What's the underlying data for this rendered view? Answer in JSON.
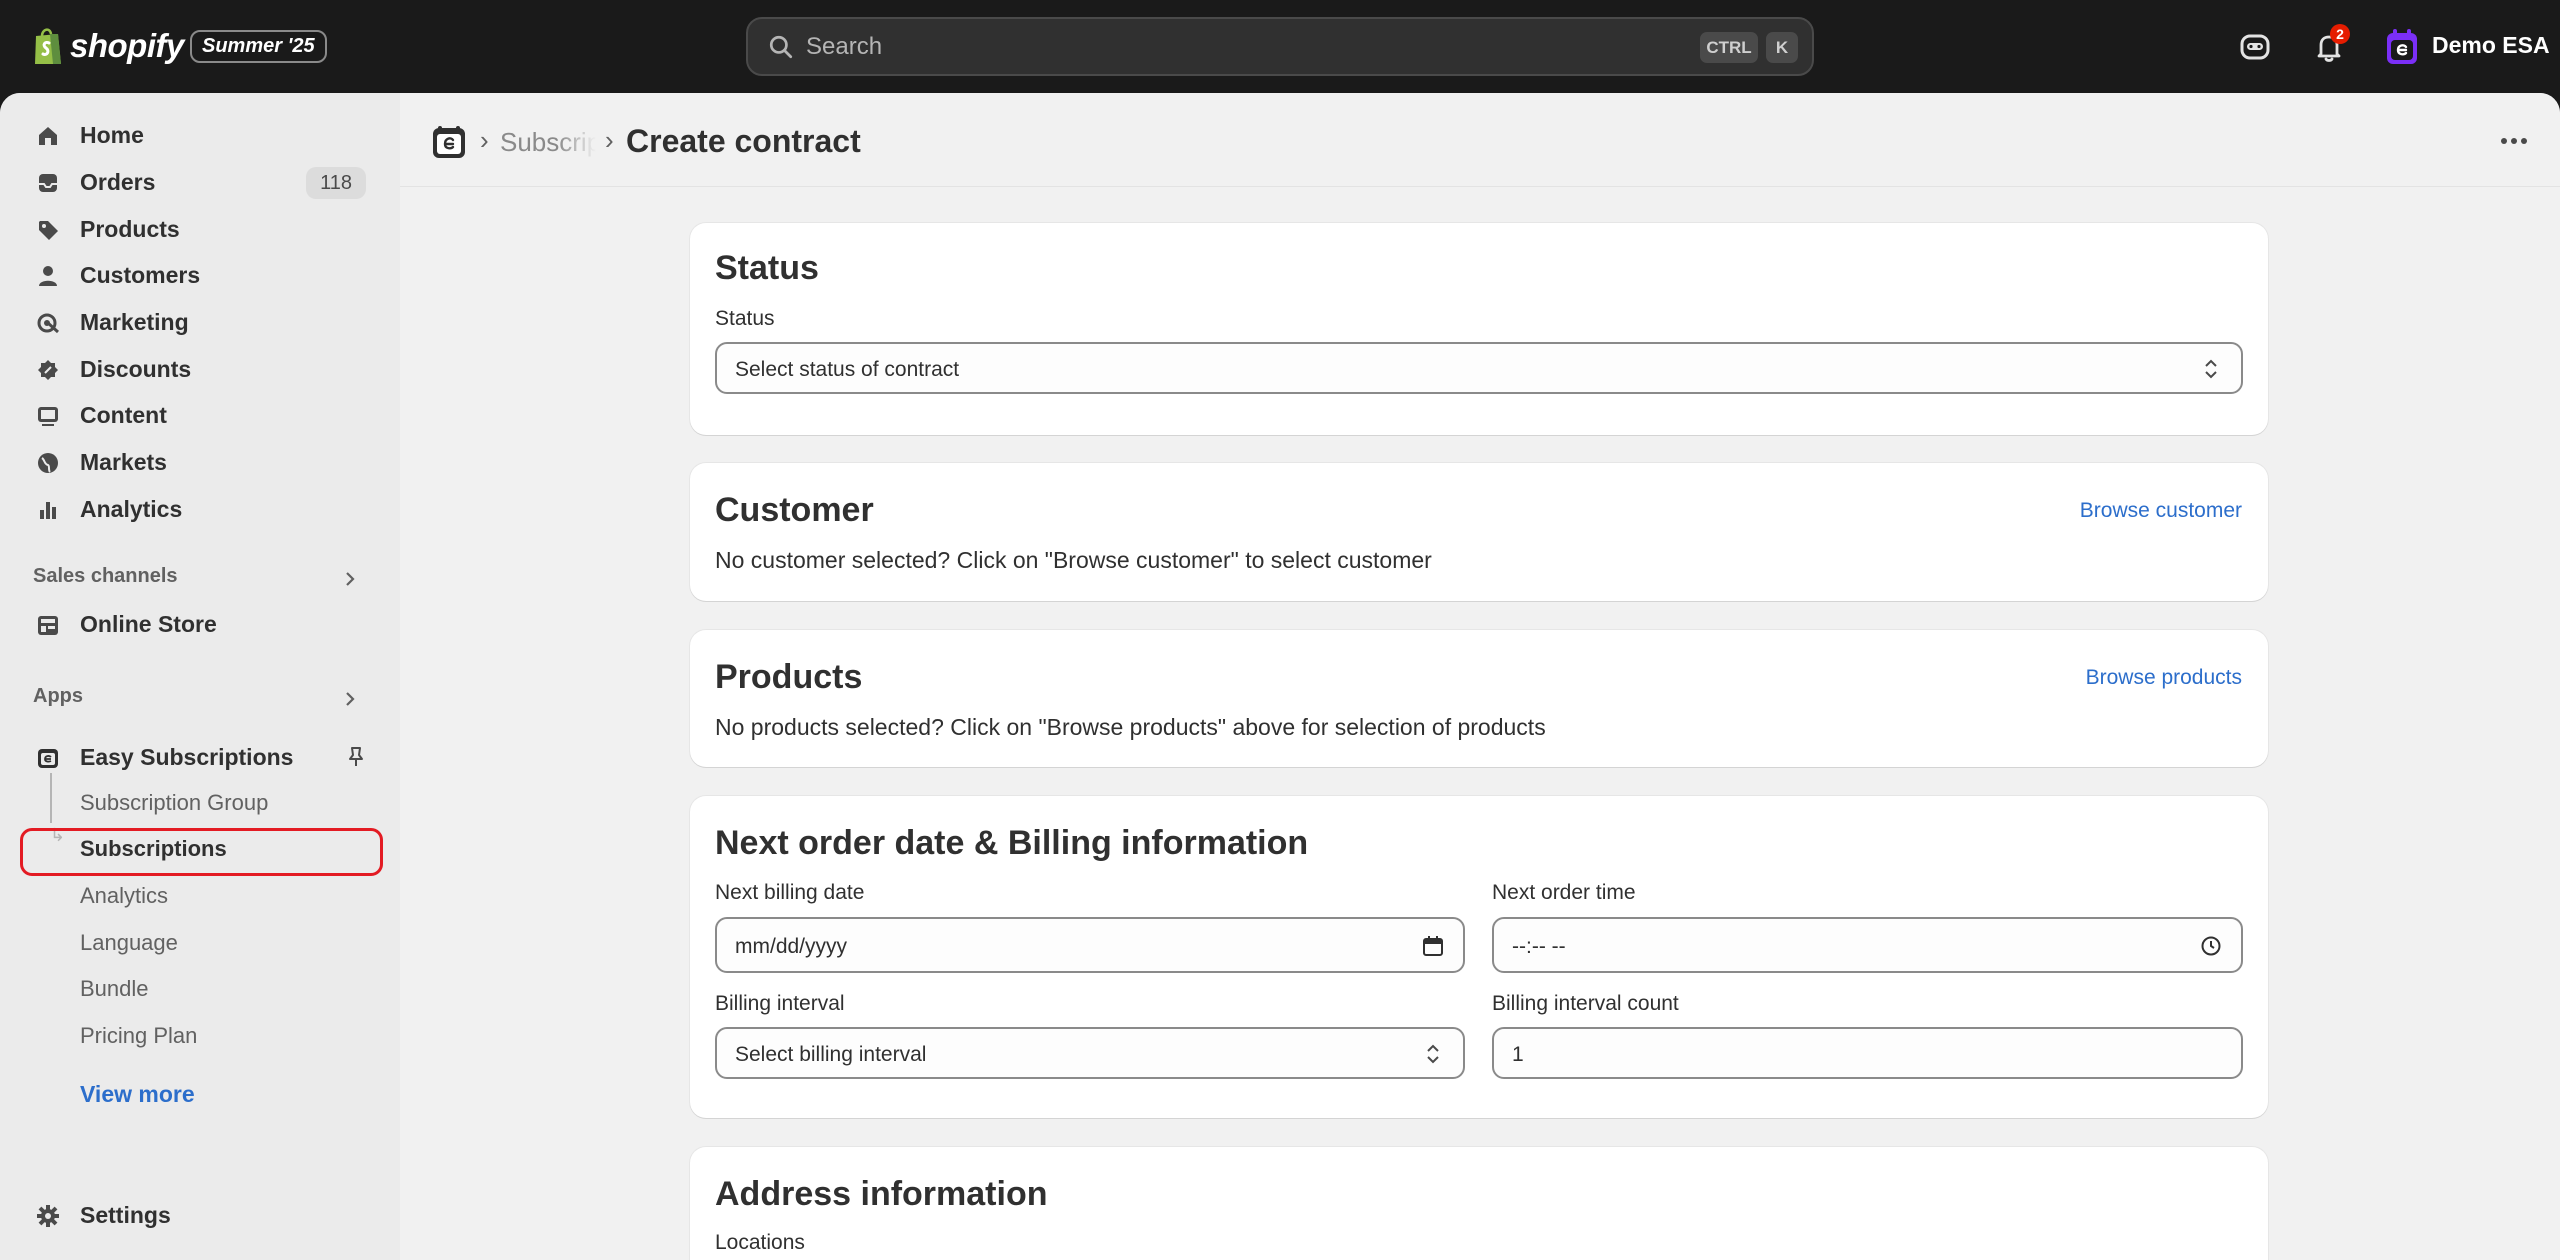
{
  "topbar": {
    "brand": "shopify",
    "edition": "Summer '25",
    "search_placeholder": "Search",
    "kbd_ctrl": "CTRL",
    "kbd_k": "K",
    "notifications_count": "2",
    "store_name": "Demo ESA"
  },
  "sidebar": {
    "items": [
      {
        "label": "Home",
        "icon": "home-icon"
      },
      {
        "label": "Orders",
        "icon": "orders-icon",
        "badge": "118"
      },
      {
        "label": "Products",
        "icon": "tag-icon"
      },
      {
        "label": "Customers",
        "icon": "person-icon"
      },
      {
        "label": "Marketing",
        "icon": "target-icon"
      },
      {
        "label": "Discounts",
        "icon": "discount-icon"
      },
      {
        "label": "Content",
        "icon": "image-icon"
      },
      {
        "label": "Markets",
        "icon": "globe-icon"
      },
      {
        "label": "Analytics",
        "icon": "chart-bar-icon"
      }
    ],
    "sales_channels_label": "Sales channels",
    "online_store_label": "Online Store",
    "apps_label": "Apps",
    "app_name": "Easy Subscriptions",
    "app_subitems": [
      "Subscription Group",
      "Subscriptions",
      "Analytics",
      "Language",
      "Bundle",
      "Pricing Plan"
    ],
    "view_more": "View more",
    "settings_label": "Settings"
  },
  "header": {
    "breadcrumb_parent": "Subscriptions",
    "title": "Create contract"
  },
  "status_card": {
    "title": "Status",
    "field_label": "Status",
    "select_value": "Select status of contract"
  },
  "customer_card": {
    "title": "Customer",
    "action": "Browse customer",
    "description": "No customer selected? Click on \"Browse customer\" to select customer"
  },
  "products_card": {
    "title": "Products",
    "action": "Browse products",
    "description": "No products selected? Click on \"Browse products\" above for selection of products"
  },
  "billing_card": {
    "title": "Next order date & Billing information",
    "next_billing_label": "Next billing date",
    "next_billing_placeholder": "mm/dd/yyyy",
    "next_order_time_label": "Next order time",
    "next_order_time_placeholder": "--:-- --",
    "billing_interval_label": "Billing interval",
    "billing_interval_value": "Select billing interval",
    "billing_count_label": "Billing interval count",
    "billing_count_value": "1"
  },
  "address_card": {
    "title": "Address information",
    "locations_label": "Locations"
  },
  "colors": {
    "accent_link": "#2c6ecb",
    "highlight_outline": "#e31b23",
    "topbar_bg": "#1a1a1a",
    "app_purple": "#7b2ff7"
  }
}
